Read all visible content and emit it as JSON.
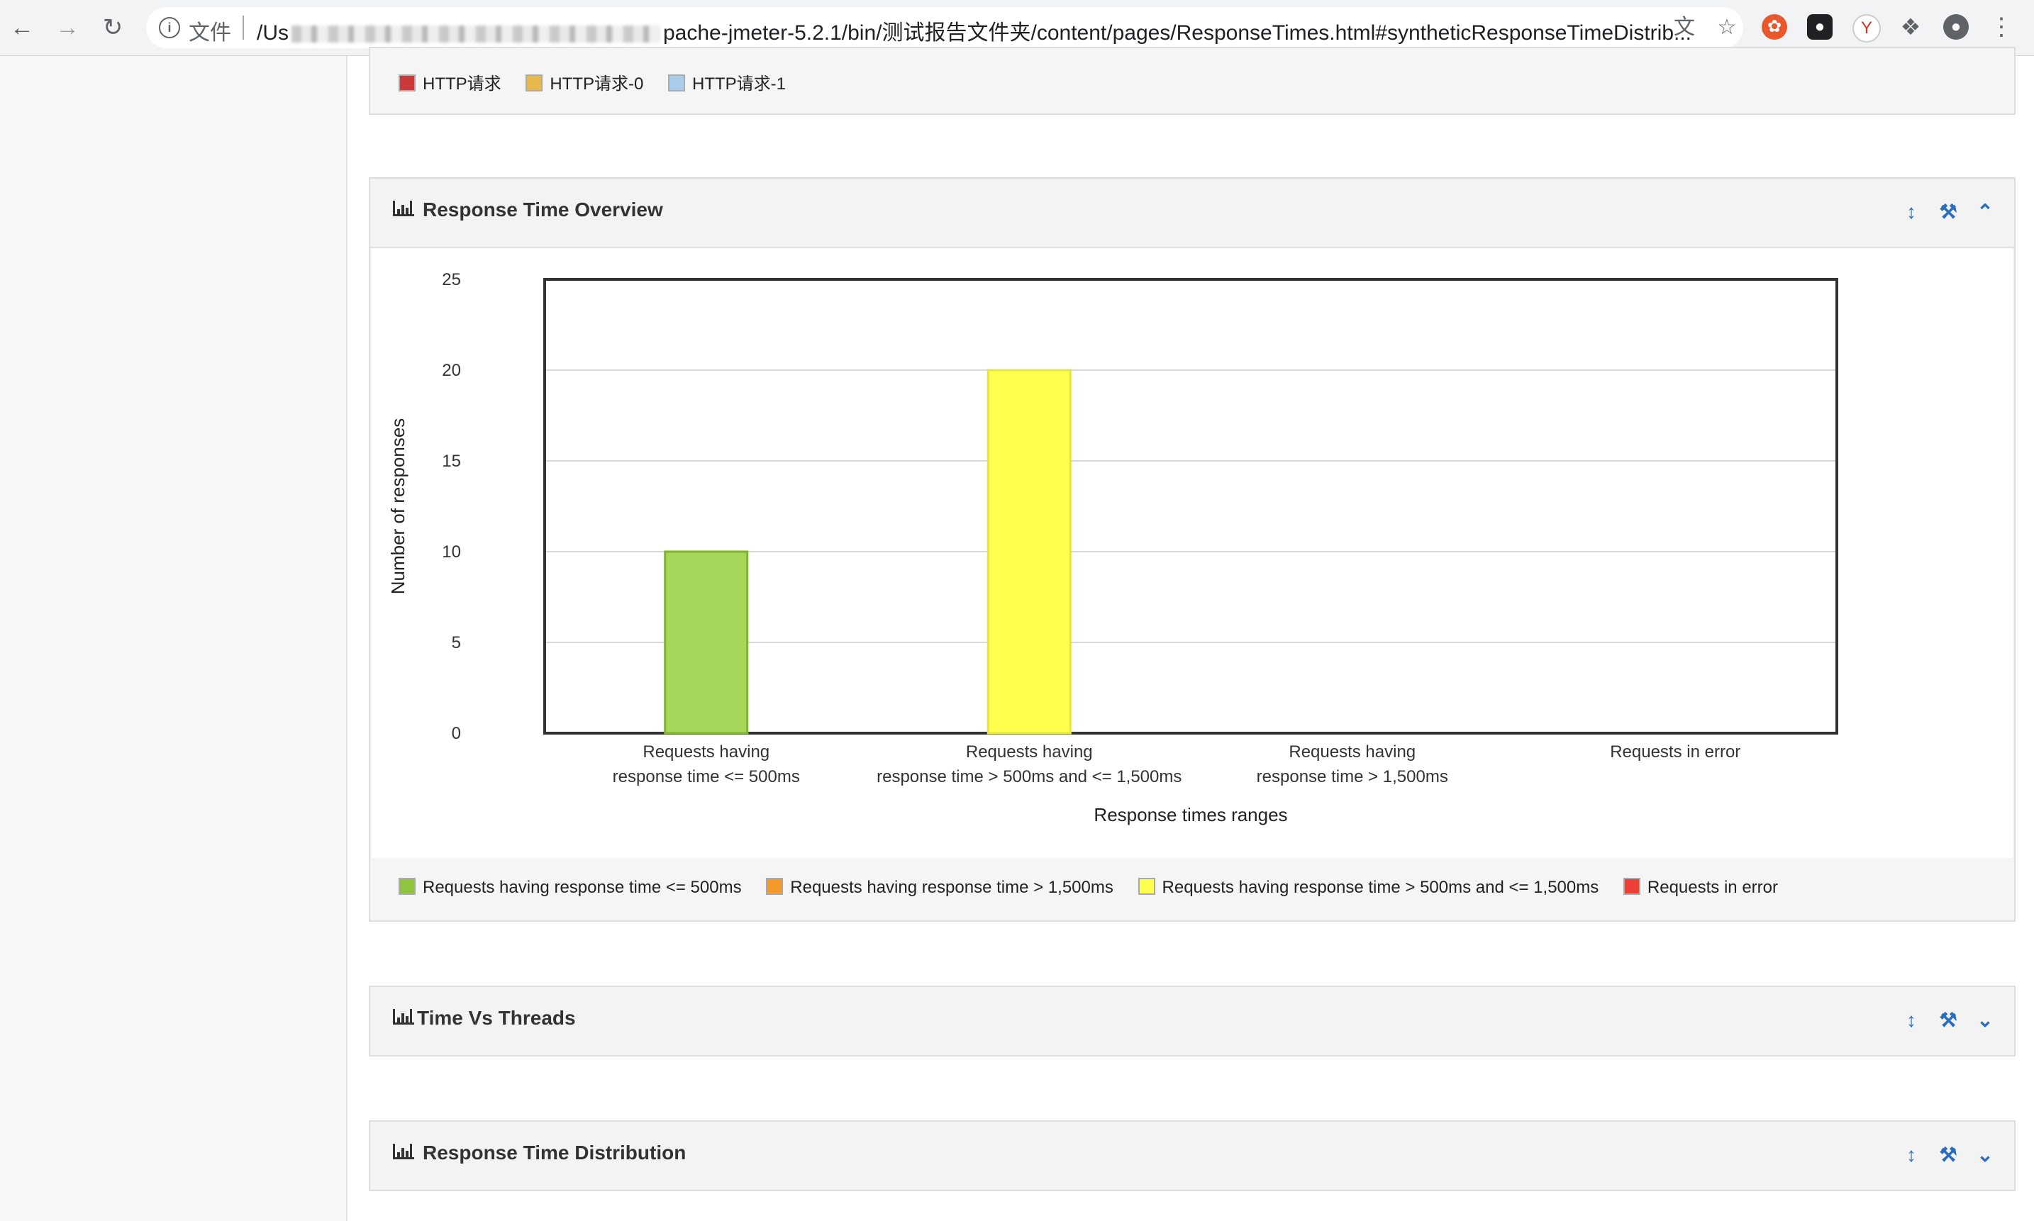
{
  "browser": {
    "scheme_label": "文件",
    "url_prefix": "/Us",
    "url_suffix": "pache-jmeter-5.2.1/bin/测试报告文件夹/content/pages/ResponseTimes.html#syntheticResponseTimeDistrib..."
  },
  "top_legend": {
    "items": [
      {
        "label": "HTTP请求",
        "color": "#cb3a3a"
      },
      {
        "label": "HTTP请求-0",
        "color": "#e8b94a"
      },
      {
        "label": "HTTP请求-1",
        "color": "#a9cdea"
      }
    ]
  },
  "overview": {
    "title": "Response Time Overview",
    "legend": [
      {
        "label": "Requests having response time <= 500ms",
        "color": "#8fc43f"
      },
      {
        "label": "Requests having response time > 1,500ms",
        "color": "#f39a2a"
      },
      {
        "label": "Requests having response time > 500ms and <= 1,500ms",
        "color": "#ffff4d"
      },
      {
        "label": "Requests in error",
        "color": "#ee4035"
      }
    ]
  },
  "chart_data": {
    "type": "bar",
    "categories": [
      [
        "Requests having",
        "response time <= 500ms"
      ],
      [
        "Requests having",
        "response time > 500ms and <= 1,500ms"
      ],
      [
        "Requests having",
        "response time > 1,500ms"
      ],
      [
        "Requests in error"
      ]
    ],
    "values": [
      10,
      20,
      0,
      0
    ],
    "bar_colors": [
      "#a6d65a",
      "#ffff4d",
      "#f39a2a",
      "#ee4035"
    ],
    "bar_edge_colors": [
      "#7fb32c",
      "#e6e640",
      "#d07a10",
      "#c02020"
    ],
    "xlabel": "Response times ranges",
    "ylabel": "Number of responses",
    "ylim": [
      0,
      25
    ],
    "yticks": [
      0,
      5,
      10,
      15,
      20,
      25
    ],
    "grid": true
  },
  "panels": {
    "threads_title": "Time Vs Threads",
    "distribution_title": "Response Time Distribution"
  }
}
